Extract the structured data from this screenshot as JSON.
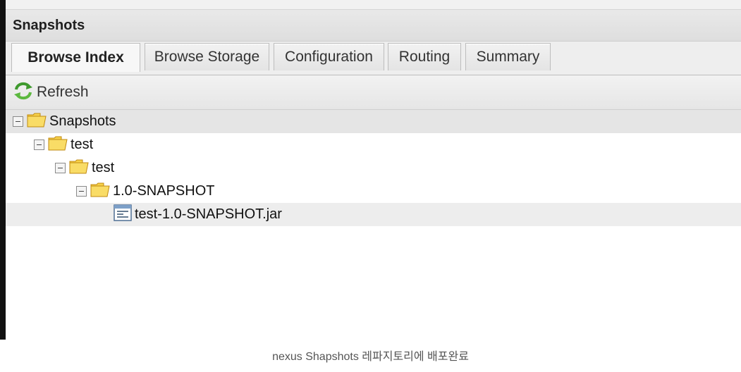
{
  "panel": {
    "title": "Snapshots"
  },
  "tabs": [
    {
      "label": "Browse Index",
      "active": true
    },
    {
      "label": "Browse Storage",
      "active": false
    },
    {
      "label": "Configuration",
      "active": false
    },
    {
      "label": "Routing",
      "active": false
    },
    {
      "label": "Summary",
      "active": false
    }
  ],
  "toolbar": {
    "refresh_label": "Refresh",
    "refresh_icon": "refresh-icon"
  },
  "tree": [
    {
      "label": "Snapshots",
      "type": "folder",
      "expanded": true
    },
    {
      "label": "test",
      "type": "folder",
      "expanded": true
    },
    {
      "label": "test",
      "type": "folder",
      "expanded": true
    },
    {
      "label": "1.0-SNAPSHOT",
      "type": "folder",
      "expanded": true
    },
    {
      "label": "test-1.0-SNAPSHOT.jar",
      "type": "file",
      "selected": true
    }
  ],
  "caption": "nexus Shapshots 레파지토리에 배포완료",
  "colors": {
    "folder_fill": "#f7d24a",
    "folder_stroke": "#c08a10",
    "refresh_green": "#3f9a2e"
  }
}
